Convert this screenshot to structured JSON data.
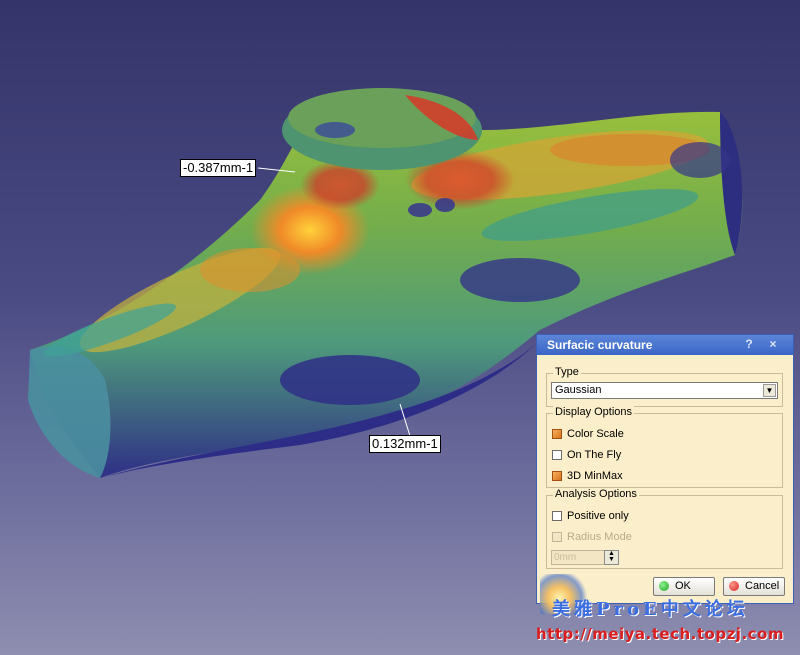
{
  "annotations": {
    "max_label": "-0.387mm-1",
    "min_label": "0.132mm-1"
  },
  "dialog": {
    "title": "Surfacic curvature",
    "help_glyph": "?",
    "close_glyph": "×",
    "type_group": {
      "label": "Type",
      "selected": "Gaussian"
    },
    "display_group": {
      "label": "Display Options",
      "color_scale": {
        "label": "Color Scale",
        "checked": true
      },
      "on_the_fly": {
        "label": "On The Fly",
        "checked": false
      },
      "minmax_3d": {
        "label": "3D MinMax",
        "checked": true
      }
    },
    "analysis_group": {
      "label": "Analysis Options",
      "positive_only": {
        "label": "Positive only",
        "checked": false
      },
      "radius_mode": {
        "label": "Radius Mode",
        "checked": false,
        "disabled": true
      },
      "radius_value": "0mm"
    },
    "ok_label": "OK",
    "cancel_label": "Cancel"
  },
  "watermark": {
    "chinese": "美雅ProE中文论坛",
    "url": "http://meiya.tech.topzj.com"
  },
  "colors": {
    "accent_title": "#3b66c6",
    "dialog_bg": "#fbeeca",
    "ok_icon": "#1fa51f",
    "cancel_icon": "#d42020"
  }
}
